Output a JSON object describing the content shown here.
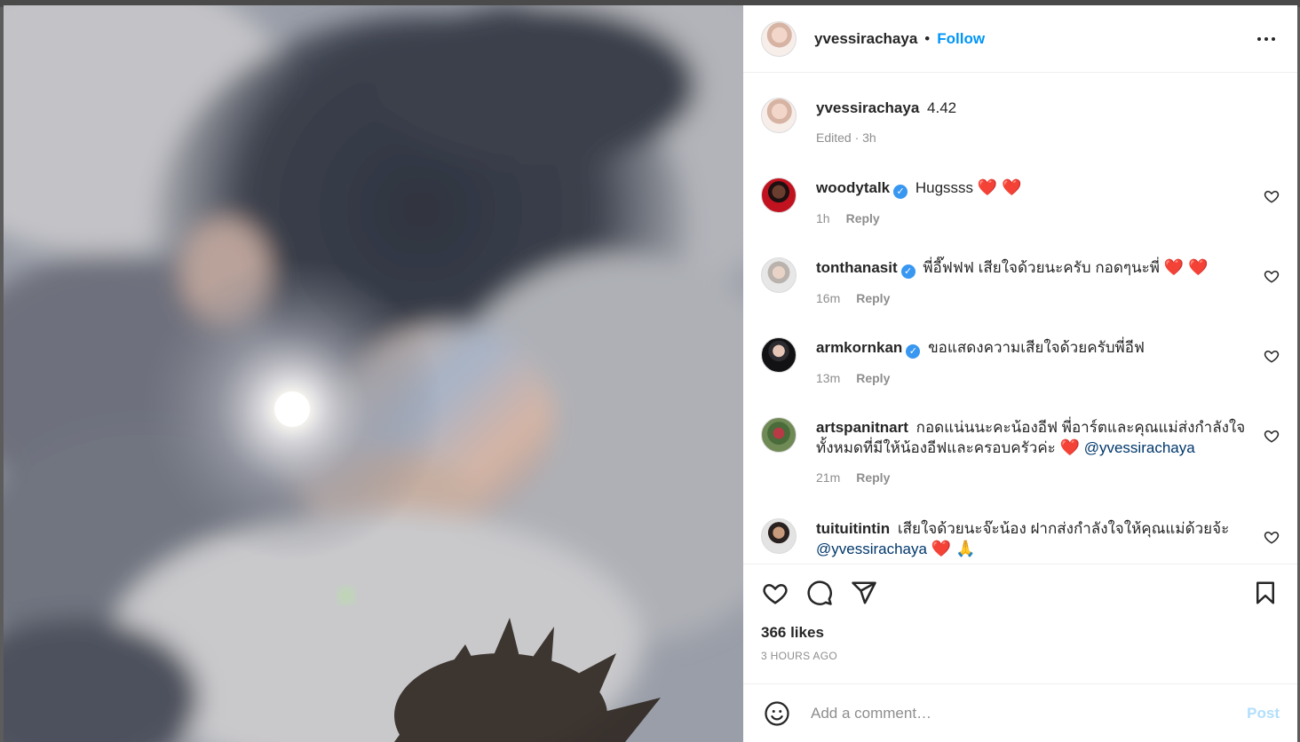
{
  "post": {
    "author": "yvessirachaya",
    "separator": "•",
    "follow_label": "Follow"
  },
  "caption": {
    "username": "yvessirachaya",
    "text": "4.42",
    "meta": "Edited · 3h"
  },
  "comments": [
    {
      "username": "woodytalk",
      "verified": true,
      "text": "Hugssss",
      "trail": "❤️ ❤️",
      "time": "1h",
      "reply_label": "Reply"
    },
    {
      "username": "tonthanasit",
      "verified": true,
      "text": "พี่อี๊ฟฟฟ เสียใจด้วยนะครับ กอดๆนะพี่",
      "trail": "❤️ ❤️",
      "time": "16m",
      "reply_label": "Reply"
    },
    {
      "username": "armkornkan",
      "verified": true,
      "text": "ขอแสดงความเสียใจด้วยครับพี่อีฟ",
      "trail": "",
      "time": "13m",
      "reply_label": "Reply"
    },
    {
      "username": "artspanitnart",
      "verified": false,
      "text": "กอดแน่นนะคะน้องอีฟ พี่อาร์ตและคุณแม่ส่งกำลังใจทั้งหมดที่มีให้น้องอีฟและครอบครัวค่ะ",
      "trail": "❤️",
      "mention": "@yvessirachaya",
      "time": "21m",
      "reply_label": "Reply"
    },
    {
      "username": "tuituitintin",
      "verified": false,
      "text": "เสียใจด้วยนะจ๊ะน้อง ฝากส่งกำลังใจให้คุณแม่ด้วยจ้ะ",
      "mention": "@yvessirachaya",
      "trail": "❤️ 🙏"
    }
  ],
  "stats": {
    "likes": "366 likes",
    "time_ago": "3 HOURS AGO"
  },
  "composer": {
    "placeholder": "Add a comment…",
    "post_label": "Post"
  },
  "colors": {
    "link": "#0095f6",
    "verified": "#3897f0",
    "heart": "#ed1c24",
    "muted": "#8e8e8e"
  },
  "icons": [
    "more-options-icon",
    "like-icon",
    "comment-icon",
    "share-icon",
    "save-icon",
    "emoji-icon",
    "verified-badge-icon"
  ]
}
